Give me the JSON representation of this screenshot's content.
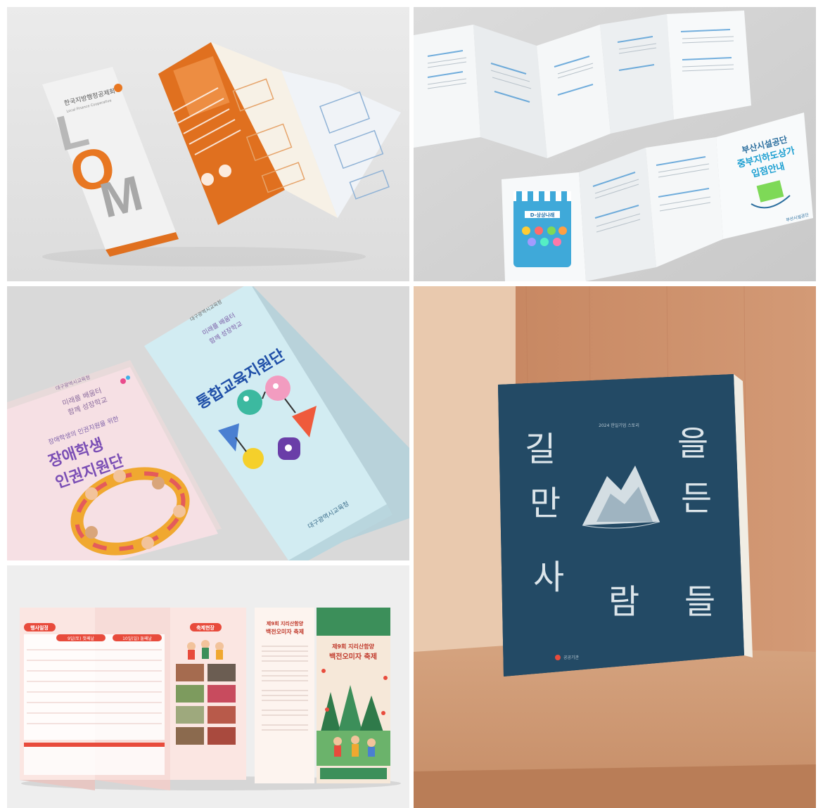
{
  "panel1": {
    "cover_org": "한국지방행정공제회",
    "cover_org_en": "Local Finance Cooperative",
    "cover_letters": [
      "L",
      "O",
      "M"
    ]
  },
  "panel2": {
    "title_line1": "부산시설공단",
    "title_line2": "중부지하도상가",
    "title_line3": "입점안내",
    "shop_label": "D-상상나래",
    "footer_org": "부산시설공단"
  },
  "panel3": {
    "left_tag": "대구광역시교육청",
    "left_slogan_line1": "미래를 배움터",
    "left_slogan_line2": "함께 성장학교",
    "left_subtitle": "장애학생의 인권지원을 위한",
    "left_title_line1": "장애학생",
    "left_title_line2": "인권지원단",
    "right_tag": "대구광역시교육청",
    "right_slogan_line1": "미래를 배움터",
    "right_slogan_line2": "함께 성장학교",
    "right_title": "통합교육지원단",
    "right_footer": "대구광역시교육청"
  },
  "panel4": {
    "title_chars": [
      "길",
      "을",
      "만",
      "든",
      "사",
      "람",
      "들"
    ],
    "subtitle": "2024 한일기업 스토리",
    "publisher": "공공기관"
  },
  "panel5": {
    "program_header": "행사일정",
    "photo_header": "축제현장",
    "day1": "9일(토) 첫째날",
    "day2": "10일(일) 둘째날",
    "side_title_line1": "제9회 지리산함양",
    "side_title_line2": "백전오미자 축제",
    "cover_title_line1": "제9회 지리산함양",
    "cover_title_line2": "백전오미자 축제"
  }
}
